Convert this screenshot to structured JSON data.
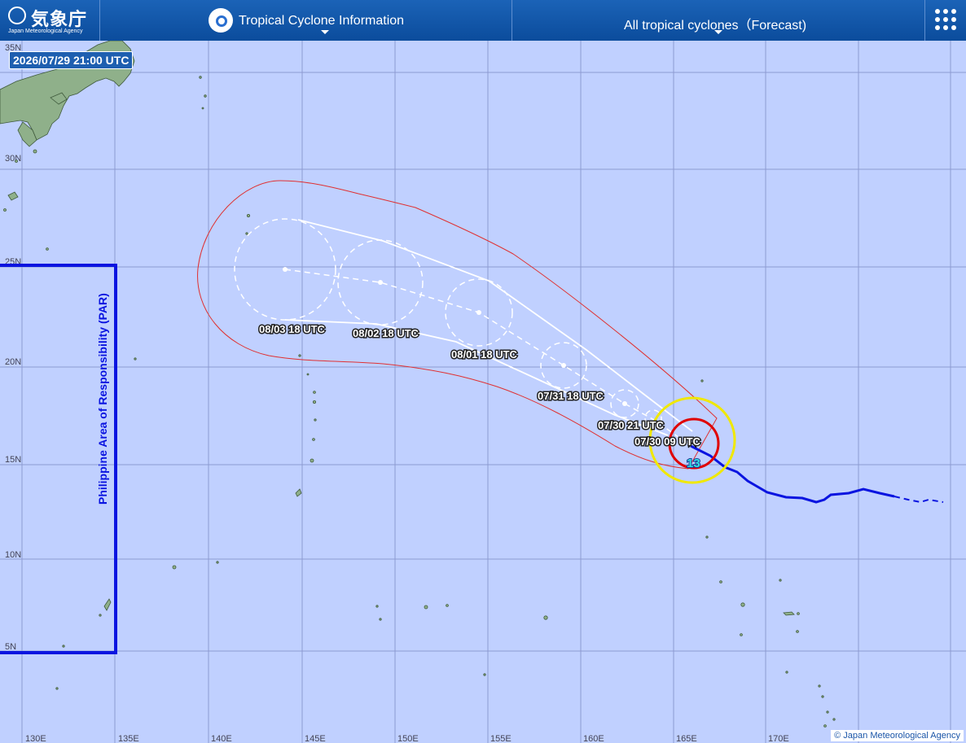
{
  "header": {
    "logo_text": "気象庁",
    "logo_sub": "Japan Meteorological Agency",
    "menu_info_label": "Tropical Cyclone Information",
    "menu_storms_label": "All tropical cyclones（Forecast)",
    "grid_icon": "app-grid-icon"
  },
  "timestamp": "2026/07/29 21:00 UTC",
  "par_label": "Philippine Area of Responsibility (PAR)",
  "credit": "© Japan Meteorological Agency",
  "storm_number": "13",
  "lat_labels": [
    "35N",
    "30N",
    "25N",
    "20N",
    "15N",
    "10N",
    "5N"
  ],
  "lon_labels": [
    "130E",
    "135E",
    "140E",
    "145E",
    "150E",
    "155E",
    "160E",
    "165E",
    "170E"
  ],
  "forecast_labels": [
    "08/03 18 UTC",
    "08/02 18 UTC",
    "08/01 18 UTC",
    "07/31 18 UTC",
    "07/30 21 UTC",
    "07/30 09 UTC"
  ],
  "track": {
    "current_position": {
      "lat": 16.1,
      "lon": 165.9
    },
    "forecast_centers": [
      {
        "time": "07/30 09 UTC",
        "lat": 16.7,
        "lon": 164.8
      },
      {
        "time": "07/30 21 UTC",
        "lat": 17.5,
        "lon": 163.3
      },
      {
        "time": "07/31 18 UTC",
        "lat": 20.1,
        "lon": 158.9
      },
      {
        "time": "08/01 18 UTC",
        "lat": 22.7,
        "lon": 154.5
      },
      {
        "time": "08/02 18 UTC",
        "lat": 24.2,
        "lon": 149.6
      },
      {
        "time": "08/03 18 UTC",
        "lat": 24.9,
        "lon": 143.9
      }
    ],
    "colors": {
      "past_track": "#0a14e0",
      "storm_area": "#e00000",
      "gale_area": "#f0e800",
      "forecast": "#ffffff",
      "warning_area": "#e03030",
      "par": "#0a14e0",
      "storm_number": "#33e0e0"
    }
  }
}
